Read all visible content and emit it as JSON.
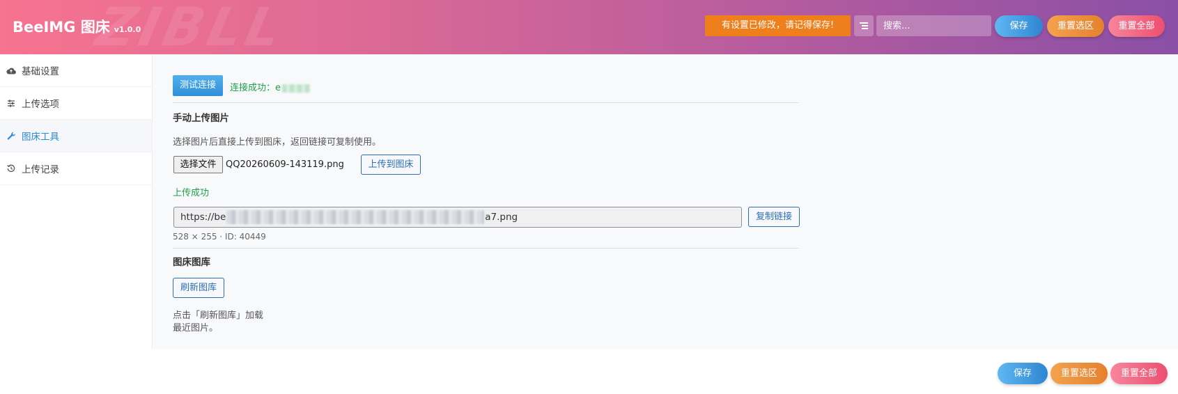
{
  "app": {
    "brand": "BeeIMG 图床",
    "version": "v1.0.0",
    "watermark": "ZIBLL",
    "unsaved_notice": "有设置已修改，请记得保存!",
    "search_placeholder": "搜索...",
    "save_label": "保存",
    "reset_section_label": "重置选区",
    "reset_all_label": "重置全部"
  },
  "sidebar": {
    "items": [
      {
        "label": "基础设置",
        "icon": "cloud-icon"
      },
      {
        "label": "上传选项",
        "icon": "sliders-icon"
      },
      {
        "label": "图床工具",
        "icon": "wrench-icon",
        "active": true
      },
      {
        "label": "上传记录",
        "icon": "history-icon"
      }
    ]
  },
  "main": {
    "test_button": "测试连接",
    "connection_status": "连接成功：e",
    "manual_upload": {
      "title": "手动上传图片",
      "description": "选择图片后直接上传到图床，返回链接可复制使用。",
      "choose_file_label": "选择文件",
      "file_name": "QQ20260609-143119.png",
      "upload_button": "上传到图床",
      "upload_status": "上传成功",
      "url_prefix": "https://be",
      "url_suffix": "a7.png",
      "copy_button": "复制链接",
      "image_meta": "528 × 255 · ID: 40449"
    },
    "gallery": {
      "title": "图床图库",
      "refresh_button": "刷新图库",
      "hint_line1": "点击「刷新图库」加载",
      "hint_line2": "最近图片。"
    }
  },
  "colors": {
    "header_gradient_start": "#f7738f",
    "header_gradient_end": "#8a4fa6",
    "notice": "#ef7f1a",
    "success_text": "#1fa045",
    "accent_blue": "#2b8ad6"
  }
}
